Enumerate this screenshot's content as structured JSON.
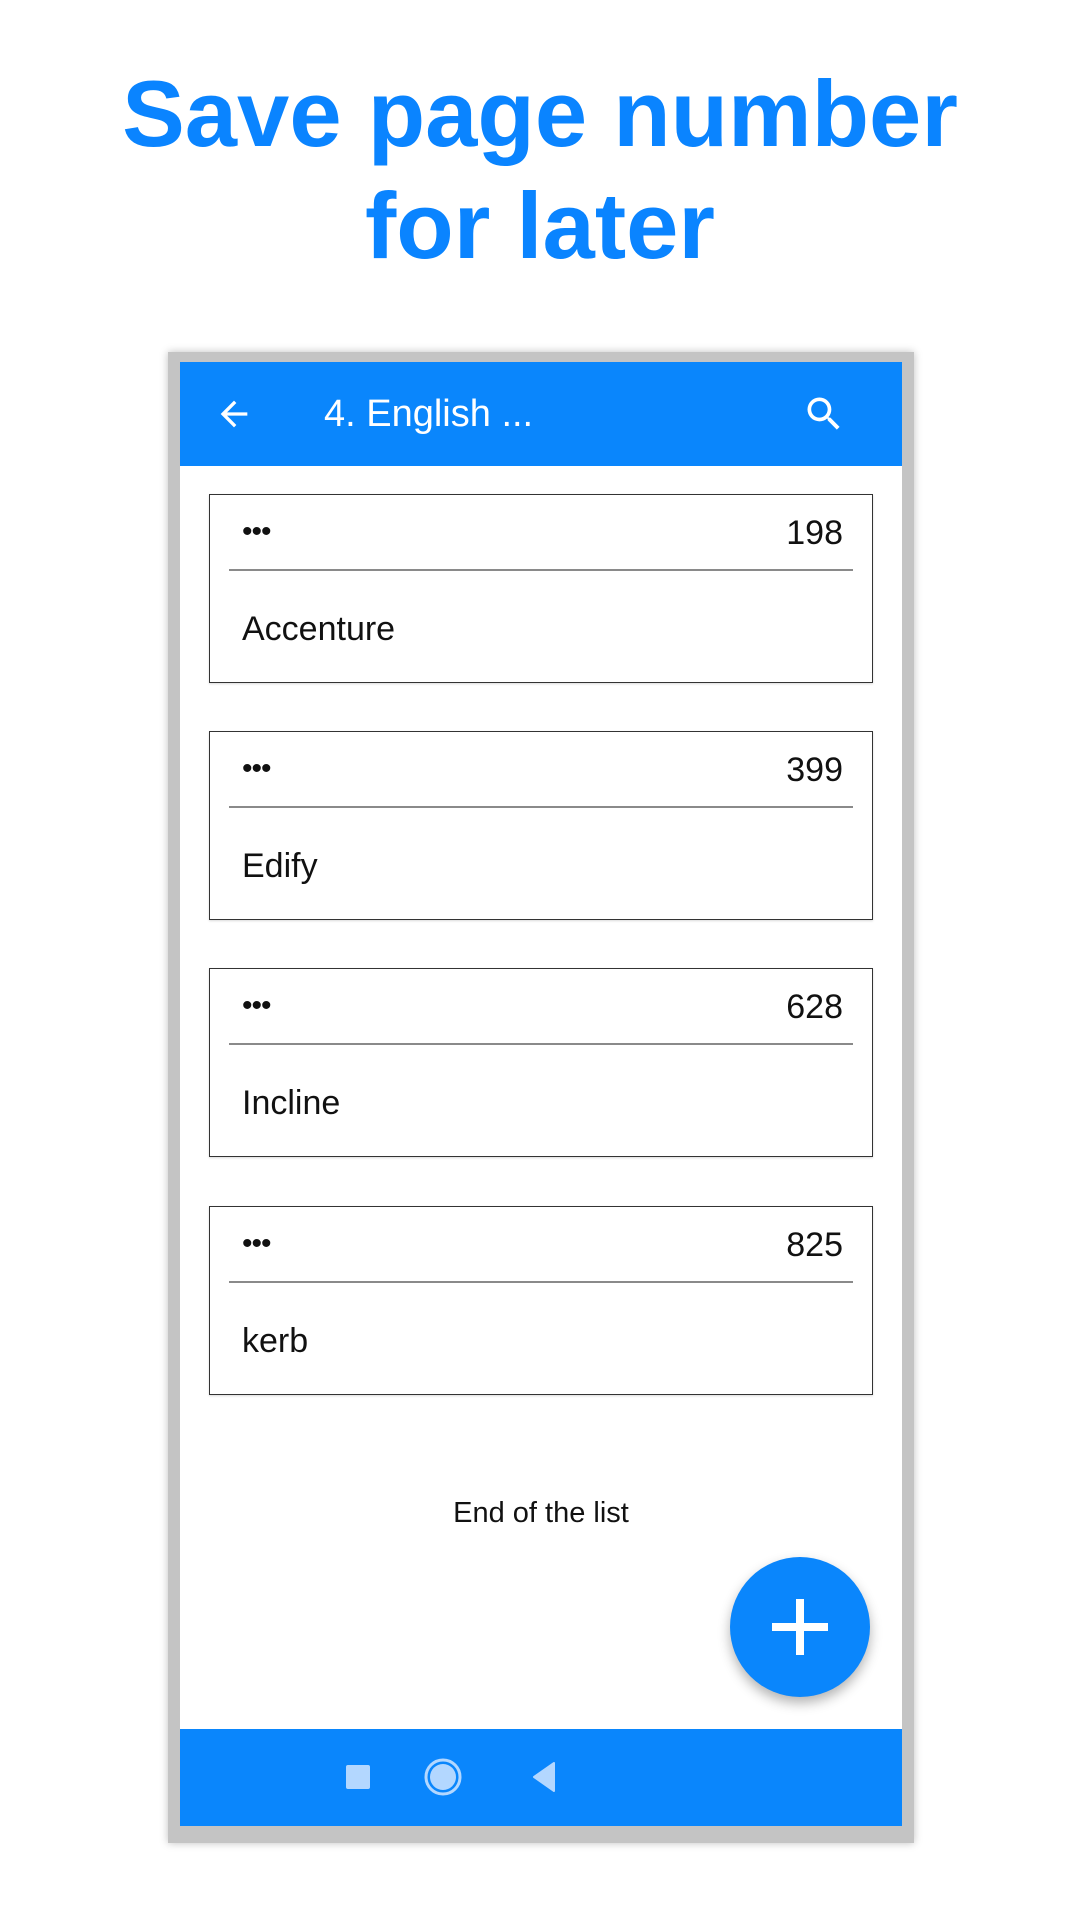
{
  "headline": {
    "line1": "Save page number",
    "line2": "for later"
  },
  "appbar": {
    "back_icon": "arrow-left-icon",
    "title": "4. English  ...",
    "search_icon": "search-icon"
  },
  "cards": [
    {
      "menu": "•••",
      "page": "198",
      "word": "Accenture"
    },
    {
      "menu": "•••",
      "page": "399",
      "word": "Edify"
    },
    {
      "menu": "•••",
      "page": "628",
      "word": "Incline"
    },
    {
      "menu": "•••",
      "page": "825",
      "word": "kerb"
    }
  ],
  "list_footer": "End of the list",
  "fab": {
    "icon": "plus-icon"
  },
  "navbar": {
    "items": [
      {
        "icon": "recents-square-icon"
      },
      {
        "icon": "home-circle-icon"
      },
      {
        "icon": "back-triangle-icon"
      }
    ]
  },
  "colors": {
    "accent": "#0a86fc",
    "headline": "#0a84ff",
    "nav_icon": "#b3d7ff"
  }
}
